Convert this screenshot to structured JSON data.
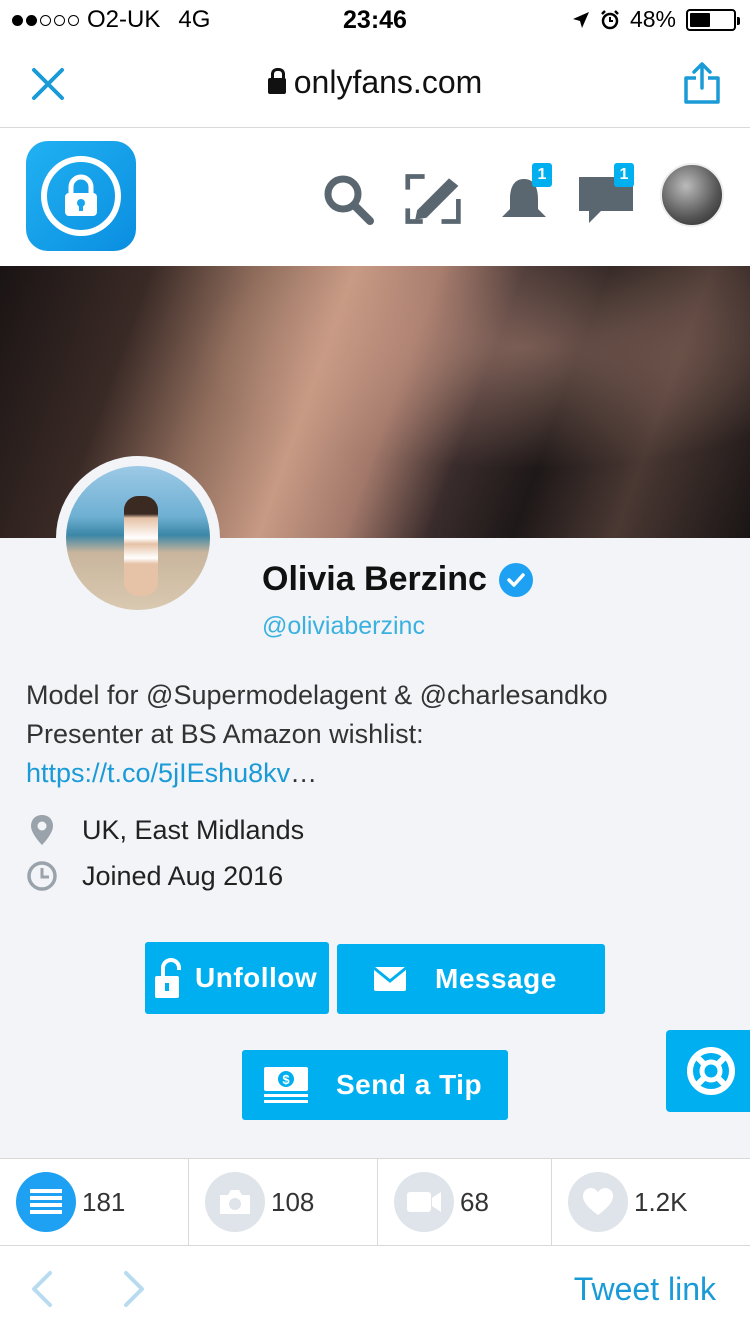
{
  "status_bar": {
    "carrier": "O2-UK",
    "network": "4G",
    "time": "23:46",
    "battery": "48%",
    "battery_level": 0.48
  },
  "browser": {
    "url": "onlyfans.com",
    "close_icon": "close-icon",
    "share_icon": "share-icon"
  },
  "header": {
    "logo_icon": "lock-icon",
    "icons": [
      "search-icon",
      "compose-icon",
      "bell-icon",
      "chat-icon"
    ],
    "notifications_badge": "1",
    "messages_badge": "1"
  },
  "profile": {
    "name": "Olivia Berzinc",
    "handle": "@oliviaberzinc",
    "bio_line1": "Model for @Supermodelagent & @charlesandko",
    "bio_line2": "Presenter at BS Amazon wishlist:",
    "bio_link": "https://t.co/5jIEshu8kv",
    "bio_ellipsis": "…",
    "location": "UK, East Midlands",
    "joined": "Joined Aug 2016"
  },
  "actions": {
    "unfollow": "Unfollow",
    "message": "Message",
    "tip": "Send a Tip"
  },
  "stats": {
    "posts": "181",
    "photos": "108",
    "videos": "68",
    "likes": "1.2K"
  },
  "bottom": {
    "tweet_link": "Tweet link"
  },
  "colors": {
    "accent": "#00aff0",
    "link": "#1a9bd7",
    "background": "#f2f4f7"
  }
}
